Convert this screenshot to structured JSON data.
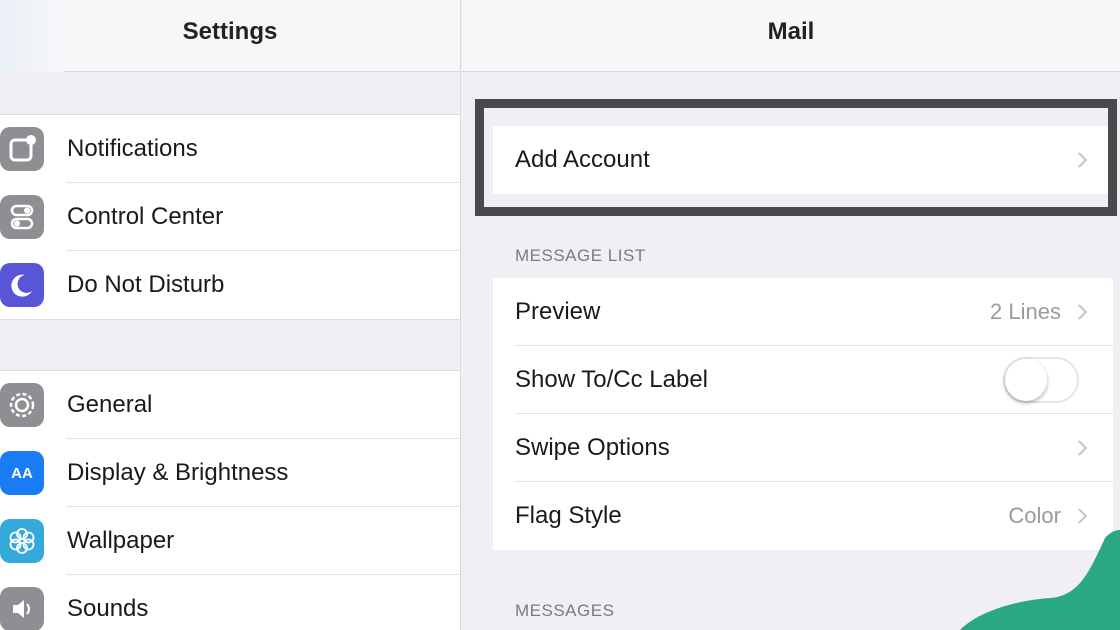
{
  "left": {
    "title": "Settings",
    "group1": [
      {
        "label": "Notifications",
        "icon": "notifications-icon",
        "color": "#8e8e93"
      },
      {
        "label": "Control Center",
        "icon": "control-center-icon",
        "color": "#8e8e93"
      },
      {
        "label": "Do Not Disturb",
        "icon": "moon-icon",
        "color": "#5856d6"
      }
    ],
    "group2": [
      {
        "label": "General",
        "icon": "gear-icon",
        "color": "#8e8e93"
      },
      {
        "label": "Display & Brightness",
        "icon": "display-brightness-icon",
        "color": "#1a7cf5",
        "glyph": "AA"
      },
      {
        "label": "Wallpaper",
        "icon": "wallpaper-flower-icon",
        "color": "#34aadc"
      },
      {
        "label": "Sounds",
        "icon": "speaker-icon",
        "color": "#8e8e93"
      }
    ]
  },
  "right": {
    "title": "Mail",
    "add_account": "Add Account",
    "section_message_list": "MESSAGE LIST",
    "message_list": [
      {
        "label": "Preview",
        "value": "2 Lines",
        "type": "disclosure"
      },
      {
        "label": "Show To/Cc Label",
        "value": "",
        "type": "toggle",
        "on": false
      },
      {
        "label": "Swipe Options",
        "value": "",
        "type": "disclosure"
      },
      {
        "label": "Flag Style",
        "value": "Color",
        "type": "disclosure"
      }
    ],
    "section_messages": "MESSAGES"
  },
  "colors": {
    "background": "#efeff4",
    "highlight_border": "#4a4a4d",
    "accent_blob": "#2aa882"
  }
}
